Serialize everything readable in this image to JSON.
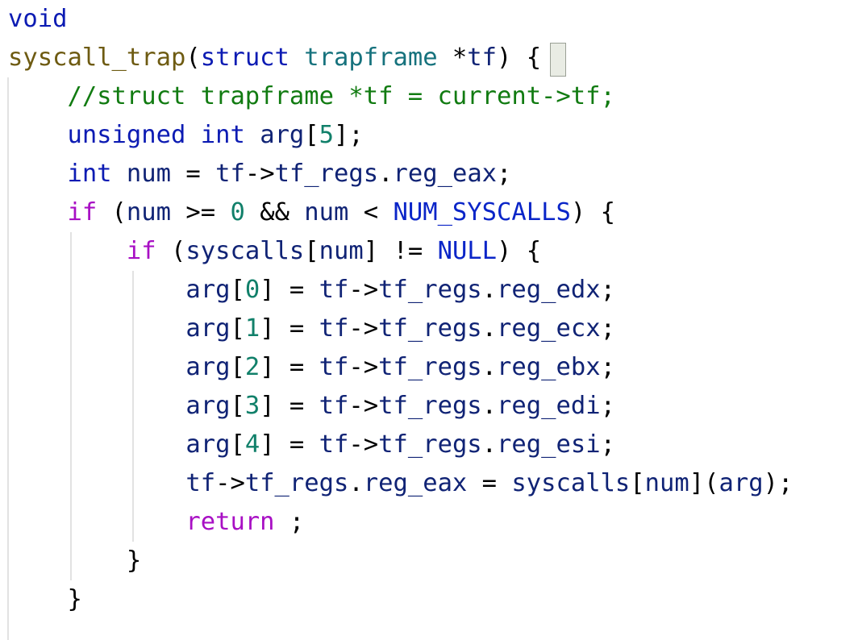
{
  "code_editor": {
    "language": "C",
    "colors": {
      "keyword": "#0c1bb3",
      "control": "#a80fc4",
      "function": "#6e5b12",
      "type": "#16727d",
      "variable": "#102375",
      "number": "#11806a",
      "macro": "#0a25c8",
      "comment": "#117b11",
      "plain": "#000000",
      "indent_guide": "#e2e2e2",
      "brace_match": "#e9ece4"
    },
    "lines": [
      [
        {
          "t": "void",
          "k": "kw"
        }
      ],
      [
        {
          "t": "syscall_trap",
          "k": "fn"
        },
        {
          "t": "(",
          "k": "plain"
        },
        {
          "t": "struct",
          "k": "kw"
        },
        {
          "t": " ",
          "k": "plain"
        },
        {
          "t": "trapframe",
          "k": "type"
        },
        {
          "t": " *",
          "k": "plain"
        },
        {
          "t": "tf",
          "k": "var"
        },
        {
          "t": ") ",
          "k": "plain"
        },
        {
          "t": "{",
          "k": "plain"
        }
      ],
      [
        {
          "t": "    ",
          "k": "plain"
        },
        {
          "t": "//struct trapframe *tf = current->tf;",
          "k": "comment"
        }
      ],
      [
        {
          "t": "    ",
          "k": "plain"
        },
        {
          "t": "unsigned",
          "k": "kw"
        },
        {
          "t": " ",
          "k": "plain"
        },
        {
          "t": "int",
          "k": "kw"
        },
        {
          "t": " ",
          "k": "plain"
        },
        {
          "t": "arg",
          "k": "var"
        },
        {
          "t": "[",
          "k": "plain"
        },
        {
          "t": "5",
          "k": "num"
        },
        {
          "t": "];",
          "k": "plain"
        }
      ],
      [
        {
          "t": "    ",
          "k": "plain"
        },
        {
          "t": "int",
          "k": "kw"
        },
        {
          "t": " ",
          "k": "plain"
        },
        {
          "t": "num",
          "k": "var"
        },
        {
          "t": " = ",
          "k": "plain"
        },
        {
          "t": "tf",
          "k": "var"
        },
        {
          "t": "->",
          "k": "plain"
        },
        {
          "t": "tf_regs",
          "k": "var"
        },
        {
          "t": ".",
          "k": "plain"
        },
        {
          "t": "reg_eax",
          "k": "var"
        },
        {
          "t": ";",
          "k": "plain"
        }
      ],
      [
        {
          "t": "    ",
          "k": "plain"
        },
        {
          "t": "if",
          "k": "ctl"
        },
        {
          "t": " (",
          "k": "plain"
        },
        {
          "t": "num",
          "k": "var"
        },
        {
          "t": " >= ",
          "k": "plain"
        },
        {
          "t": "0",
          "k": "num"
        },
        {
          "t": " && ",
          "k": "plain"
        },
        {
          "t": "num",
          "k": "var"
        },
        {
          "t": " < ",
          "k": "plain"
        },
        {
          "t": "NUM_SYSCALLS",
          "k": "macro"
        },
        {
          "t": ") {",
          "k": "plain"
        }
      ],
      [
        {
          "t": "        ",
          "k": "plain"
        },
        {
          "t": "if",
          "k": "ctl"
        },
        {
          "t": " (",
          "k": "plain"
        },
        {
          "t": "syscalls",
          "k": "var"
        },
        {
          "t": "[",
          "k": "plain"
        },
        {
          "t": "num",
          "k": "var"
        },
        {
          "t": "] != ",
          "k": "plain"
        },
        {
          "t": "NULL",
          "k": "macro"
        },
        {
          "t": ") {",
          "k": "plain"
        }
      ],
      [
        {
          "t": "            ",
          "k": "plain"
        },
        {
          "t": "arg",
          "k": "var"
        },
        {
          "t": "[",
          "k": "plain"
        },
        {
          "t": "0",
          "k": "num"
        },
        {
          "t": "] = ",
          "k": "plain"
        },
        {
          "t": "tf",
          "k": "var"
        },
        {
          "t": "->",
          "k": "plain"
        },
        {
          "t": "tf_regs",
          "k": "var"
        },
        {
          "t": ".",
          "k": "plain"
        },
        {
          "t": "reg_edx",
          "k": "var"
        },
        {
          "t": ";",
          "k": "plain"
        }
      ],
      [
        {
          "t": "            ",
          "k": "plain"
        },
        {
          "t": "arg",
          "k": "var"
        },
        {
          "t": "[",
          "k": "plain"
        },
        {
          "t": "1",
          "k": "num"
        },
        {
          "t": "] = ",
          "k": "plain"
        },
        {
          "t": "tf",
          "k": "var"
        },
        {
          "t": "->",
          "k": "plain"
        },
        {
          "t": "tf_regs",
          "k": "var"
        },
        {
          "t": ".",
          "k": "plain"
        },
        {
          "t": "reg_ecx",
          "k": "var"
        },
        {
          "t": ";",
          "k": "plain"
        }
      ],
      [
        {
          "t": "            ",
          "k": "plain"
        },
        {
          "t": "arg",
          "k": "var"
        },
        {
          "t": "[",
          "k": "plain"
        },
        {
          "t": "2",
          "k": "num"
        },
        {
          "t": "] = ",
          "k": "plain"
        },
        {
          "t": "tf",
          "k": "var"
        },
        {
          "t": "->",
          "k": "plain"
        },
        {
          "t": "tf_regs",
          "k": "var"
        },
        {
          "t": ".",
          "k": "plain"
        },
        {
          "t": "reg_ebx",
          "k": "var"
        },
        {
          "t": ";",
          "k": "plain"
        }
      ],
      [
        {
          "t": "            ",
          "k": "plain"
        },
        {
          "t": "arg",
          "k": "var"
        },
        {
          "t": "[",
          "k": "plain"
        },
        {
          "t": "3",
          "k": "num"
        },
        {
          "t": "] = ",
          "k": "plain"
        },
        {
          "t": "tf",
          "k": "var"
        },
        {
          "t": "->",
          "k": "plain"
        },
        {
          "t": "tf_regs",
          "k": "var"
        },
        {
          "t": ".",
          "k": "plain"
        },
        {
          "t": "reg_edi",
          "k": "var"
        },
        {
          "t": ";",
          "k": "plain"
        }
      ],
      [
        {
          "t": "            ",
          "k": "plain"
        },
        {
          "t": "arg",
          "k": "var"
        },
        {
          "t": "[",
          "k": "plain"
        },
        {
          "t": "4",
          "k": "num"
        },
        {
          "t": "] = ",
          "k": "plain"
        },
        {
          "t": "tf",
          "k": "var"
        },
        {
          "t": "->",
          "k": "plain"
        },
        {
          "t": "tf_regs",
          "k": "var"
        },
        {
          "t": ".",
          "k": "plain"
        },
        {
          "t": "reg_esi",
          "k": "var"
        },
        {
          "t": ";",
          "k": "plain"
        }
      ],
      [
        {
          "t": "            ",
          "k": "plain"
        },
        {
          "t": "tf",
          "k": "var"
        },
        {
          "t": "->",
          "k": "plain"
        },
        {
          "t": "tf_regs",
          "k": "var"
        },
        {
          "t": ".",
          "k": "plain"
        },
        {
          "t": "reg_eax",
          "k": "var"
        },
        {
          "t": " = ",
          "k": "plain"
        },
        {
          "t": "syscalls",
          "k": "var"
        },
        {
          "t": "[",
          "k": "plain"
        },
        {
          "t": "num",
          "k": "var"
        },
        {
          "t": "](",
          "k": "plain"
        },
        {
          "t": "arg",
          "k": "var"
        },
        {
          "t": ");",
          "k": "plain"
        }
      ],
      [
        {
          "t": "            ",
          "k": "plain"
        },
        {
          "t": "return",
          "k": "ctl"
        },
        {
          "t": " ;",
          "k": "plain"
        }
      ],
      [
        {
          "t": "        ",
          "k": "plain"
        },
        {
          "t": "}",
          "k": "plain"
        }
      ],
      [
        {
          "t": "    ",
          "k": "plain"
        },
        {
          "t": "}",
          "k": "plain"
        }
      ]
    ]
  }
}
